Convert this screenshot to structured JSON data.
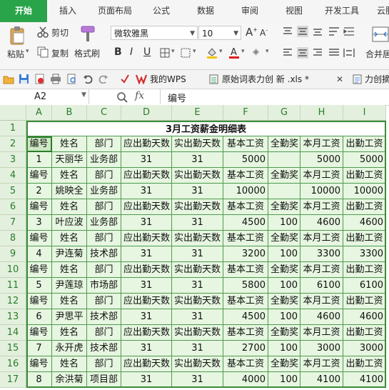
{
  "tabs": [
    "开始",
    "插入",
    "页面布局",
    "公式",
    "数据",
    "审阅",
    "视图",
    "开发工具",
    "云服"
  ],
  "ribbon": {
    "paste_label": "粘贴",
    "cut_label": "剪切",
    "copy_label": "复制",
    "format_painter_label": "格式刷",
    "font_name": "微软雅黑",
    "font_size": "10",
    "merge_center_label": "合并居中"
  },
  "quick_bar": {
    "doc_tabs": [
      "我的WPS",
      "原始词表力创 新 .xls *",
      "力创摘"
    ]
  },
  "formula_bar": {
    "cell_ref": "A2",
    "fx_label": "fx",
    "content": "编号"
  },
  "sheet": {
    "columns": [
      "A",
      "B",
      "C",
      "D",
      "E",
      "F",
      "G",
      "H",
      "I"
    ],
    "row_numbers": [
      "1",
      "2",
      "3",
      "4",
      "5",
      "6",
      "7",
      "8",
      "9",
      "10",
      "11",
      "12",
      "13",
      "14",
      "15",
      "16",
      "17"
    ],
    "title": "3月工资薪金明细表",
    "header": [
      "编号",
      "姓名",
      "部门",
      "应出勤天数",
      "实出勤天数",
      "基本工资",
      "全勤奖",
      "本月工资",
      "出勤工资"
    ],
    "records": [
      [
        "1",
        "天丽华",
        "业务部",
        "31",
        "31",
        "5000",
        "",
        "5000",
        "5000"
      ],
      [
        "2",
        "姚映全",
        "业务部",
        "31",
        "31",
        "10000",
        "",
        "10000",
        "10000"
      ],
      [
        "3",
        "叶应波",
        "业务部",
        "31",
        "31",
        "4500",
        "100",
        "4600",
        "4600"
      ],
      [
        "4",
        "尹连菊",
        "技术部",
        "31",
        "31",
        "3200",
        "100",
        "3300",
        "3300"
      ],
      [
        "5",
        "尹莲琼",
        "市场部",
        "31",
        "31",
        "5800",
        "100",
        "6100",
        "6100"
      ],
      [
        "6",
        "尹思平",
        "技术部",
        "31",
        "31",
        "4500",
        "100",
        "4600",
        "4600"
      ],
      [
        "7",
        "永开虎",
        "技术部",
        "31",
        "31",
        "2700",
        "100",
        "3000",
        "3000"
      ],
      [
        "8",
        "余洪菊",
        "项目部",
        "31",
        "31",
        "4000",
        "100",
        "4100",
        "4100"
      ]
    ]
  },
  "colors": {
    "accent": "#2aa44b",
    "grid_border": "#4f9a4f",
    "cell_fill": "#e6f6e0"
  }
}
